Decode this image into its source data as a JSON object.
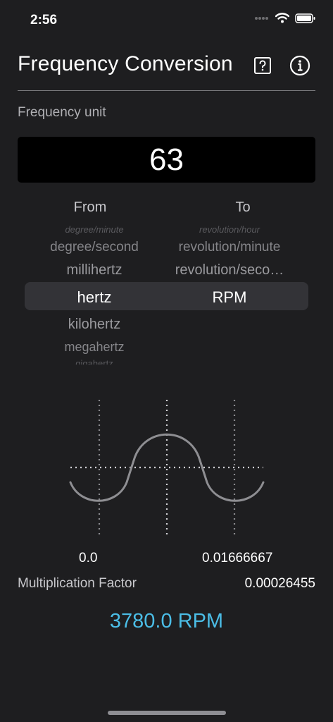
{
  "status": {
    "time": "2:56"
  },
  "header": {
    "title": "Frequency Conversion",
    "help_icon": "question-square-icon",
    "info_icon": "info-circle-icon"
  },
  "input": {
    "label": "Frequency unit",
    "value": "63"
  },
  "picker": {
    "from_header": "From",
    "to_header": "To",
    "from": {
      "above3": "degree/minute",
      "above2": "degree/second",
      "above1": "millihertz",
      "selected": "hertz",
      "below1": "kilohertz",
      "below2": "megahertz",
      "below3": "gigahertz"
    },
    "to": {
      "above3": "revolution/hour",
      "above2": "revolution/minute",
      "above1": "revolution/seco…",
      "selected": "RPM"
    }
  },
  "chart": {
    "left_value": "0.0",
    "right_value": "0.01666667"
  },
  "factor": {
    "label": "Multiplication Factor",
    "value": "0.00026455"
  },
  "result": {
    "text": "3780.0 RPM",
    "color": "#4bbde6"
  }
}
